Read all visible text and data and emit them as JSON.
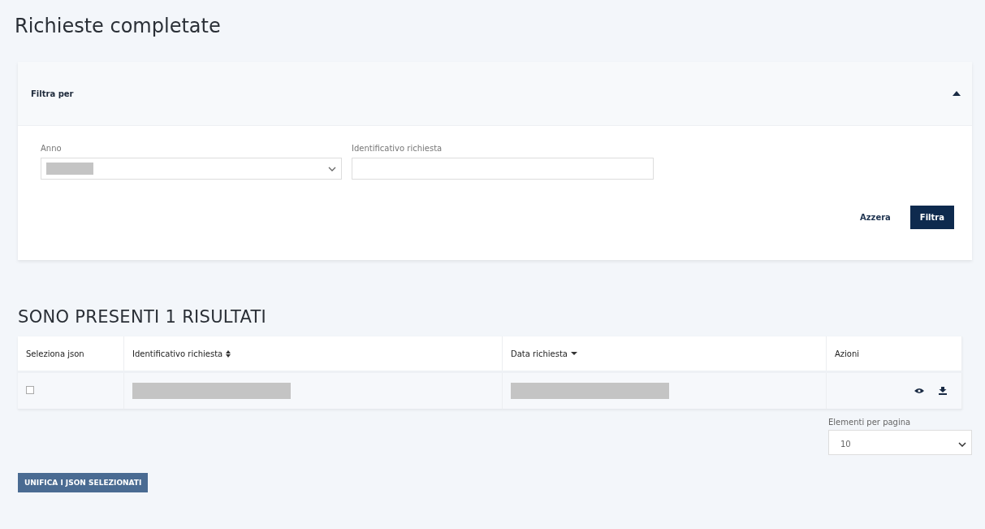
{
  "page_title": "Richieste completate",
  "filter": {
    "title": "Filtra per",
    "expanded": true,
    "fields": [
      {
        "kind": "select",
        "label": "Anno",
        "redacted": true
      },
      {
        "kind": "text",
        "label": "Identificativo richiesta"
      }
    ],
    "buttons": [
      {
        "label": "Azzera",
        "kind": "link"
      },
      {
        "label": "Filtra",
        "kind": "primary"
      }
    ]
  },
  "results_heading": "SONO PRESENTI 1 RISULTATI",
  "table": {
    "columns": [
      {
        "label": "Seleziona json",
        "kind": "plain"
      },
      {
        "label": "Identificativo richiesta",
        "kind": "sortable"
      },
      {
        "label": "Data richiesta",
        "kind": "sorted"
      },
      {
        "label": "Azioni",
        "kind": "plain"
      }
    ],
    "rows": [
      {
        "checked": false
      }
    ]
  },
  "per_page": {
    "label": "Elementi per pagina",
    "value": "10"
  },
  "merge_button": "UNIFICA I JSON SELEZIONATI"
}
